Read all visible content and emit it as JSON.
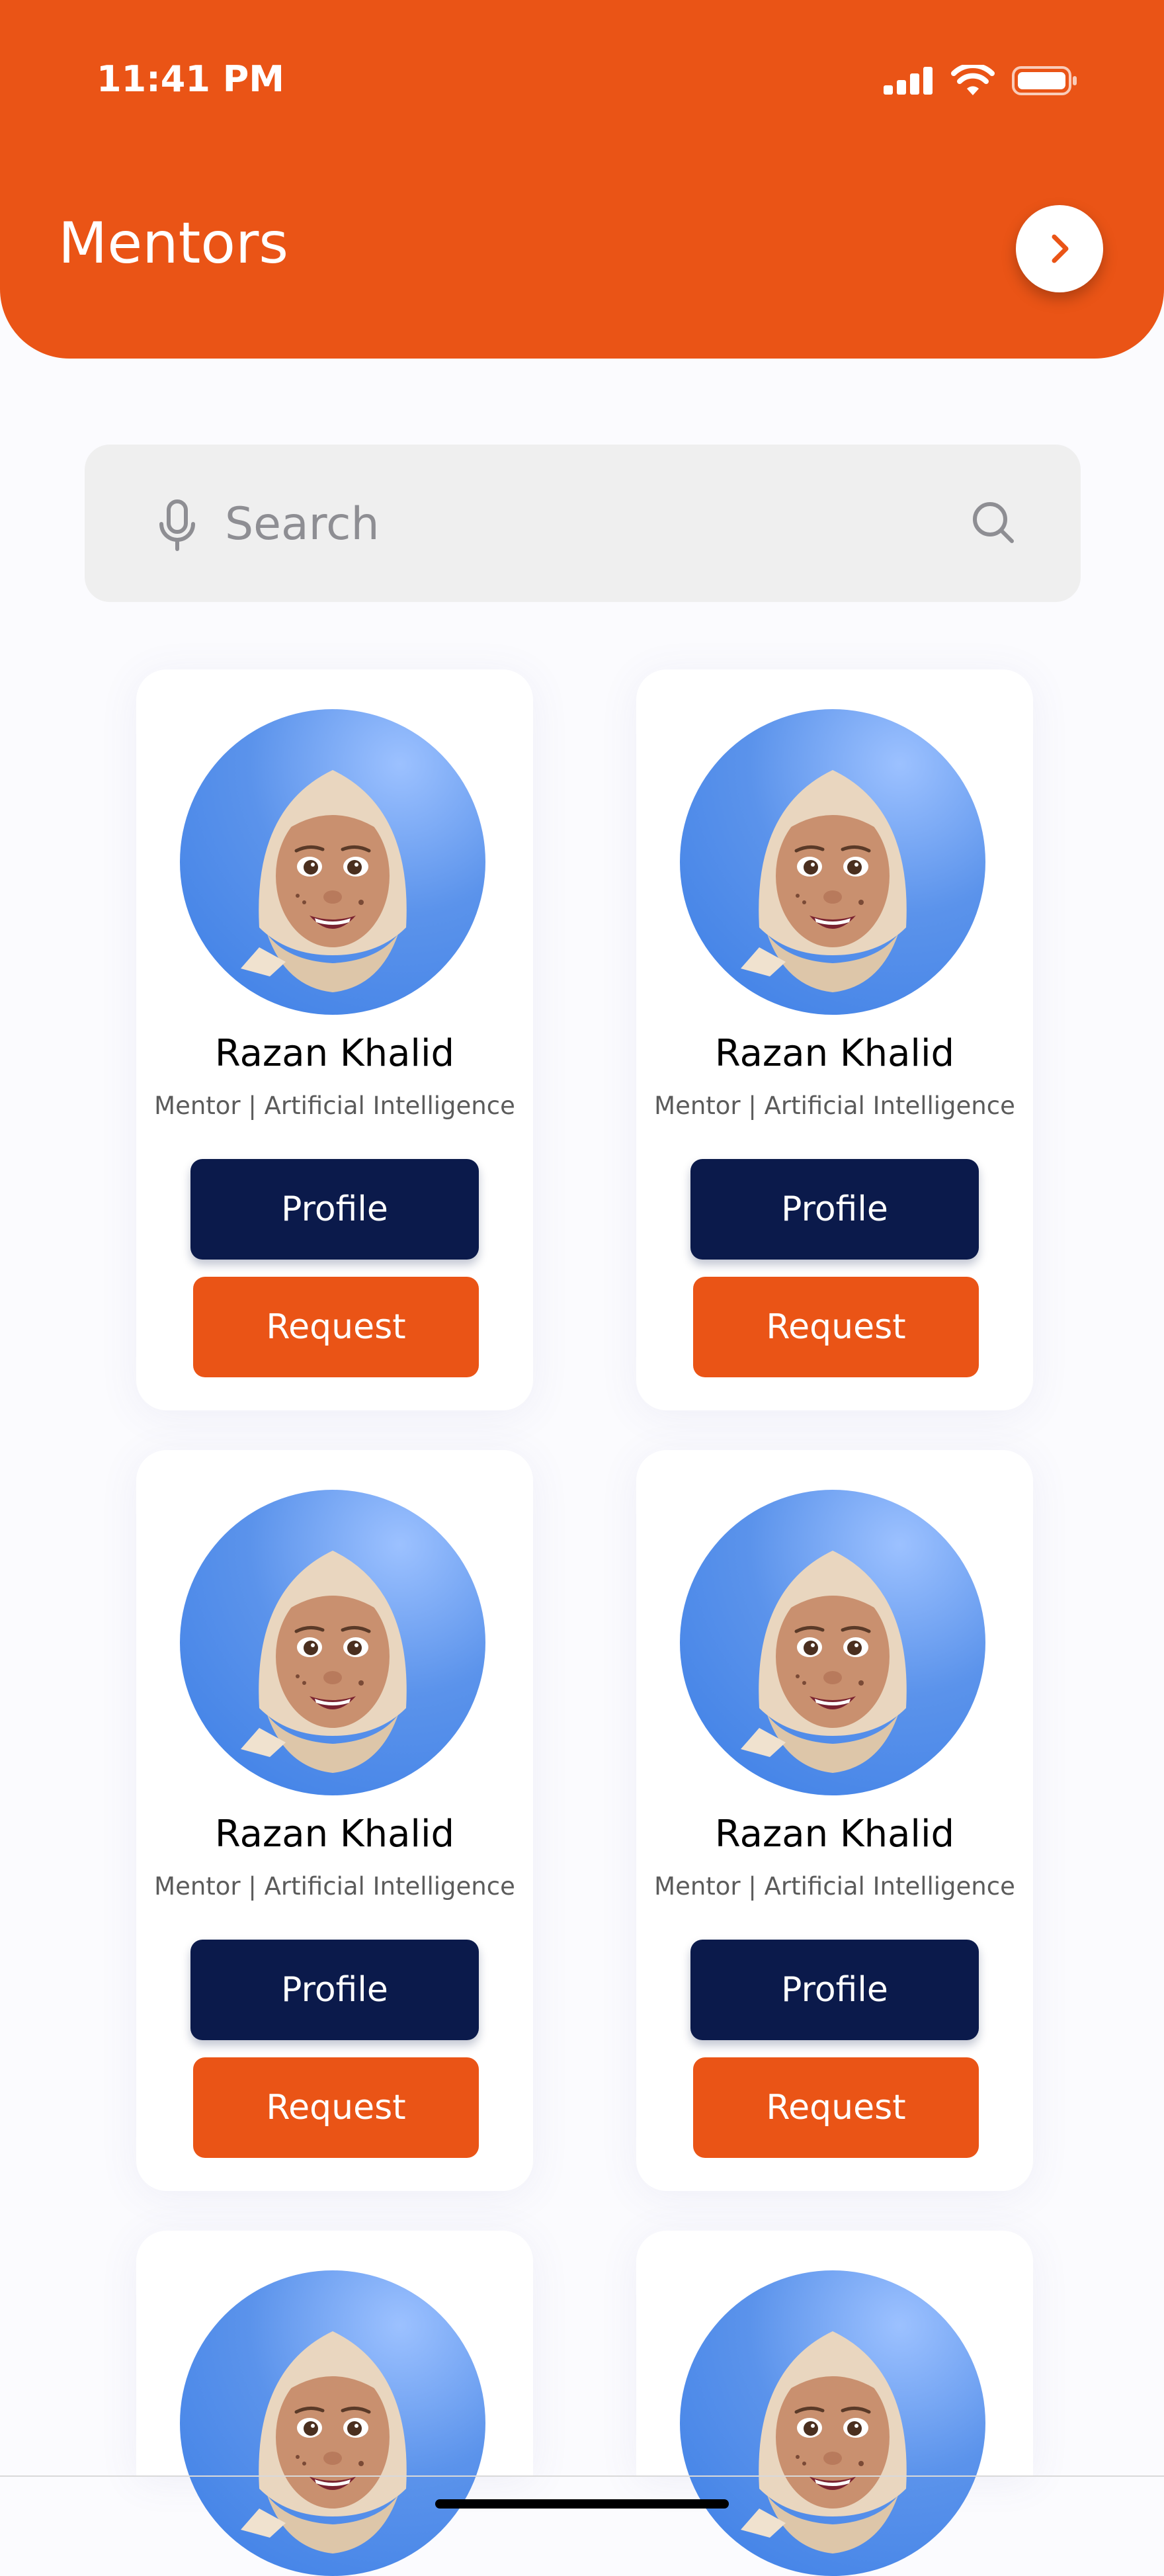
{
  "status_bar": {
    "time": "11:41 PM",
    "icons": [
      "cellular-signal-icon",
      "wifi-icon",
      "battery-icon"
    ]
  },
  "header": {
    "title": "Mentors",
    "next_icon": "chevron-right-icon",
    "background_color": "#ea5416"
  },
  "search": {
    "placeholder": "Search",
    "value": "",
    "mic_icon": "microphone-icon",
    "search_icon": "magnifier-icon"
  },
  "mentors": [
    {
      "name": "Razan Khalid",
      "role": "Mentor | Artificial Intelligence",
      "profile_label": "Profile",
      "request_label": "Request"
    },
    {
      "name": "Razan Khalid",
      "role": "Mentor | Artificial Intelligence",
      "profile_label": "Profile",
      "request_label": "Request"
    },
    {
      "name": "Razan Khalid",
      "role": "Mentor | Artificial Intelligence",
      "profile_label": "Profile",
      "request_label": "Request"
    },
    {
      "name": "Razan Khalid",
      "role": "Mentor | Artificial Intelligence",
      "profile_label": "Profile",
      "request_label": "Request"
    },
    {
      "name": "",
      "role": "",
      "profile_label": "",
      "request_label": ""
    },
    {
      "name": "",
      "role": "",
      "profile_label": "",
      "request_label": ""
    }
  ],
  "colors": {
    "accent": "#ea5416",
    "navy": "#0b1a4b",
    "avatar_blue": "#4a88ea"
  }
}
